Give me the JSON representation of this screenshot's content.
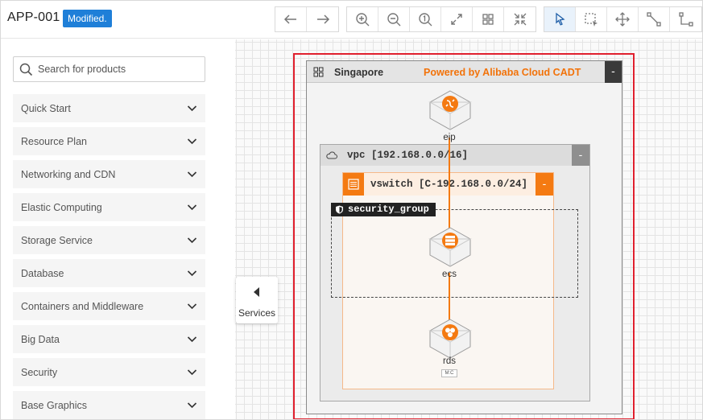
{
  "header": {
    "app_title": "APP-001",
    "status_badge": "Modified."
  },
  "toolbar": {
    "groups": [
      [
        "undo",
        "redo"
      ],
      [
        "zoom-in",
        "zoom-out",
        "zoom-reset",
        "fit-screen",
        "grid",
        "fullscreen"
      ],
      [
        "select",
        "box-select",
        "pan",
        "connect",
        "elbow-connect"
      ]
    ],
    "active_tool": "select"
  },
  "search": {
    "placeholder": "Search for products",
    "value": ""
  },
  "categories": [
    "Quick Start",
    "Resource Plan",
    "Networking and CDN",
    "Elastic Computing",
    "Storage Service",
    "Database",
    "Containers and Middleware",
    "Big Data",
    "Security",
    "Base Graphics"
  ],
  "services_toggle": {
    "label": "Services"
  },
  "diagram": {
    "region": {
      "name": "Singapore",
      "powered_by": "Powered by Alibaba Cloud CADT",
      "collapse": "-"
    },
    "vpc": {
      "name": "vpc [192.168.0.0/16]",
      "collapse": "-"
    },
    "vswitch": {
      "name": "vswitch [C-192.168.0.0/24]",
      "collapse": "-"
    },
    "security_group": {
      "name": "security_group"
    },
    "nodes": [
      {
        "id": "eip",
        "label": "eip"
      },
      {
        "id": "ecs",
        "label": "ecs"
      },
      {
        "id": "rds",
        "label": "rds",
        "tag": "M:C"
      }
    ],
    "accent_color": "#f47a12",
    "selection_color": "#e0202e"
  }
}
